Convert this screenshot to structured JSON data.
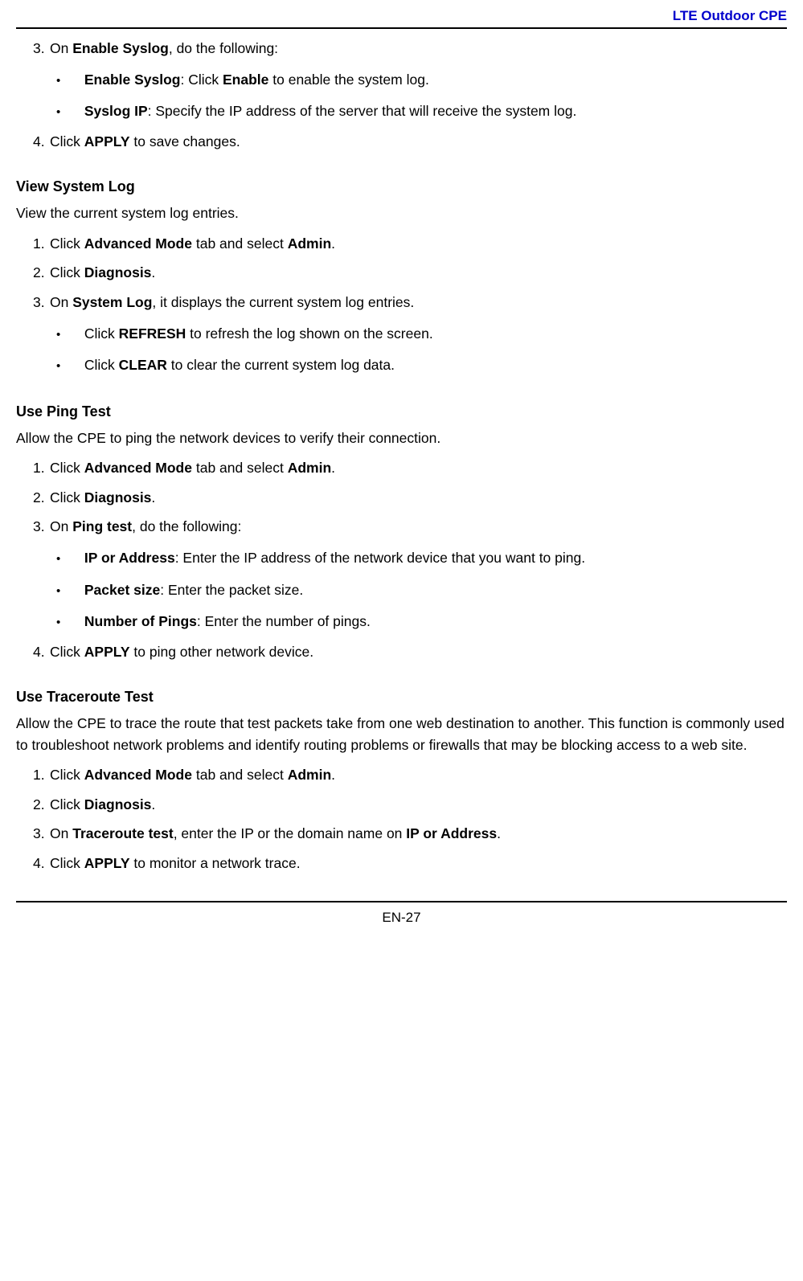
{
  "header": {
    "title": "LTE Outdoor CPE"
  },
  "s1": {
    "step3_pre": "On ",
    "step3_bold": "Enable Syslog",
    "step3_post": ", do the following:",
    "b1_bold": "Enable Syslog",
    "b1_mid": ": Click ",
    "b1_bold2": "Enable",
    "b1_post": " to enable the system log.",
    "b2_bold": "Syslog IP",
    "b2_post": ": Specify the IP address of the server that will receive the system log.",
    "step4_pre": "Click ",
    "step4_bold": "APPLY",
    "step4_post": " to save changes."
  },
  "s2": {
    "heading": "View System Log",
    "intro": "View the current system log entries.",
    "step1_pre": "Click ",
    "step1_bold": "Advanced Mode",
    "step1_mid": " tab and select ",
    "step1_bold2": "Admin",
    "step1_post": ".",
    "step2_pre": "Click ",
    "step2_bold": "Diagnosis",
    "step2_post": ".",
    "step3_pre": "On ",
    "step3_bold": "System Log",
    "step3_post": ", it displays the current system log entries.",
    "b1_pre": "Click ",
    "b1_bold": "REFRESH",
    "b1_post": " to refresh the log shown on the screen.",
    "b2_pre": "Click ",
    "b2_bold": "CLEAR",
    "b2_post": " to clear the current system log data."
  },
  "s3": {
    "heading": "Use Ping Test",
    "intro": "Allow the CPE to ping the network devices to verify their connection.",
    "step1_pre": "Click ",
    "step1_bold": "Advanced Mode",
    "step1_mid": " tab and select ",
    "step1_bold2": "Admin",
    "step1_post": ".",
    "step2_pre": "Click ",
    "step2_bold": "Diagnosis",
    "step2_post": ".",
    "step3_pre": "On ",
    "step3_bold": "Ping test",
    "step3_post": ", do the following:",
    "b1_bold": "IP or Address",
    "b1_post": ": Enter the IP address of the network device that you want to ping.",
    "b2_bold": "Packet size",
    "b2_post": ": Enter the packet size.",
    "b3_bold": "Number of Pings",
    "b3_post": ": Enter the number of pings.",
    "step4_pre": "Click ",
    "step4_bold": "APPLY",
    "step4_post": " to ping other network device."
  },
  "s4": {
    "heading": "Use Traceroute Test",
    "intro": "Allow the CPE to trace the route that test packets take from one web destination to another. This function is commonly used to troubleshoot network problems and identify routing problems or firewalls that may be blocking access to a web site.",
    "step1_pre": "Click ",
    "step1_bold": "Advanced Mode",
    "step1_mid": " tab and select ",
    "step1_bold2": "Admin",
    "step1_post": ".",
    "step2_pre": "Click ",
    "step2_bold": "Diagnosis",
    "step2_post": ".",
    "step3_pre": "On ",
    "step3_bold": "Traceroute test",
    "step3_mid": ", enter the IP or the domain name on ",
    "step3_bold2": "IP or Address",
    "step3_post": ".",
    "step4_pre": "Click ",
    "step4_bold": "APPLY",
    "step4_post": " to monitor a network trace."
  },
  "footer": {
    "page": "EN-27"
  }
}
